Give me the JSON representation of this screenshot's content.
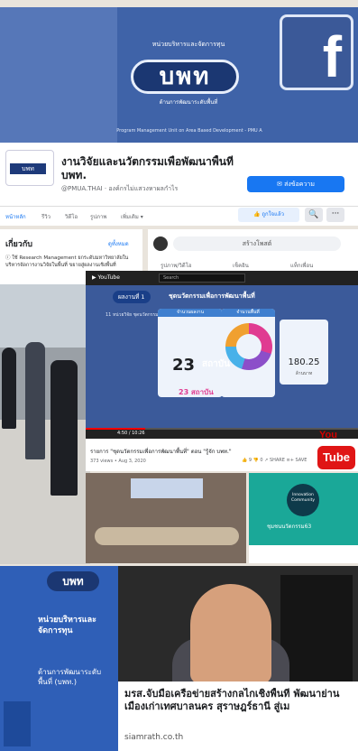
{
  "cover": {
    "top_text": "หน่วยบริหารและจัดการทุน",
    "logo_text": "บพท",
    "sub_text": "ด้านการพัฒนาระดับพื้นที่",
    "footer_text": "Program Management Unit on Area Based Development - PMU A",
    "fb_letter": "f"
  },
  "page": {
    "avatar_text": "บพท",
    "name": "งานวิจัยและนวัตกรรมเพื่อพัฒนาพื้นที่ บพท.",
    "handle": "@PMUA.THAI · องค์กรไม่แสวงหาผลกำไร",
    "message_label": "✉ ส่งข้อความ",
    "tabs": [
      "หน้าหลัก",
      "รีวิว",
      "วิดีโอ",
      "รูปภาพ",
      "เพิ่มเติม ▾"
    ],
    "like_label": "👍 ถูกใจแล้ว",
    "search_icon": "🔍",
    "more_icon": "···"
  },
  "about": {
    "title": "เกี่ยวกับ",
    "see_all": "ดูทั้งหมด",
    "text": "ⓘ ใช้ Research Management ยกระดับมหาวิทยาลัยในบริหารจัดการงานวิจัยในพื้นที่ ขยายสู่ผลงานเชิงพื้นที่"
  },
  "post": {
    "prompt": "สร้างโพสต์",
    "actions": [
      "รูปภาพ/วิดีโอ",
      "เช็คอิน",
      "แท็กเพื่อน"
    ]
  },
  "youtube": {
    "logo": "▶ YouTube",
    "search_placeholder": "Search",
    "tag": "ผลงานที่ 1",
    "slide_title": "ชุดนวัตกรรมเพื่อการพัฒนาพื้นที่",
    "slide_sub": "11 หน่วยวิจัย ชุดนวัตกรรม ที่นำมาพัฒนาพื้นที่",
    "card1_head": "จำนวนผลงาน",
    "card2_head": "จำนวนพื้นที่",
    "big_number": "23",
    "big_unit": "สถาบัน",
    "small_count": "23 สถาบัน",
    "card3_value": "180.25",
    "card3_unit": "ล้านบาท",
    "progress_fraction": 0.22,
    "time": "4:50 / 10:26",
    "caption": "รายการ \"ชุดนวัตกรรมเพื่อการพัฒนาพื้นที่\" ตอน \"รู้จัก บพท.\"",
    "views": "373 views • Aug 3, 2020",
    "actions": "👍 9   👎 0   ↗ SHARE   ≡+ SAVE",
    "badge_you": "You",
    "badge_tube": "Tube"
  },
  "innovation": {
    "circle_text": "Innovation Community",
    "label": "ชุมชนนวัตกรรม63"
  },
  "poster": {
    "logo": "บพท",
    "title": "หน่วยบริหารและจัดการทุน",
    "sub": "ด้านการพัฒนาระดับพื้นที่ (บพท.)"
  },
  "news": {
    "headline": "มรส.จับมือเครือข่ายสร้างกลไกเชิงพื้นที่ พัฒนาย่านเมืองเก่าเทศบาลนคร สุราษฎร์ธานี สู่เม",
    "source": "siamrath.co.th"
  }
}
